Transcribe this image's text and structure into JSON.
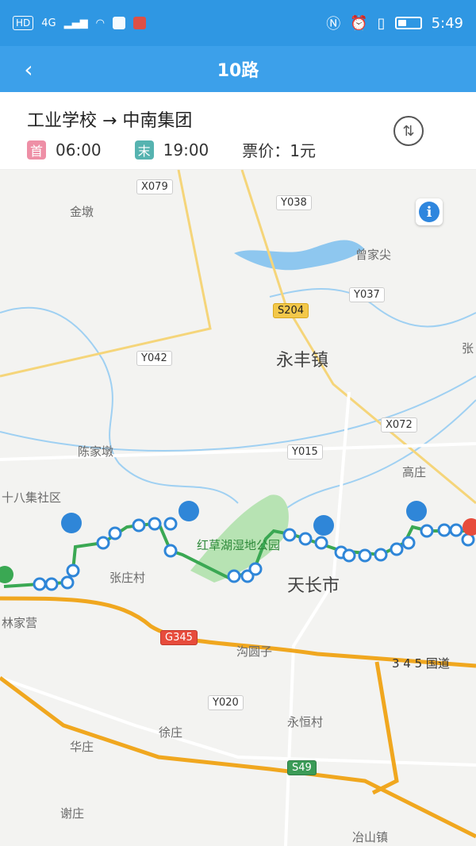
{
  "status_bar": {
    "hd": "HD",
    "network": "4G",
    "time": "5:49",
    "icons": [
      "signal-icon",
      "wifi-icon",
      "music-app-icon",
      "book-app-icon",
      "nfc-icon",
      "alarm-icon",
      "vibrate-icon",
      "battery-icon"
    ]
  },
  "nav": {
    "title": "10路",
    "back_icon": "back-arrow-icon"
  },
  "route": {
    "name": "工业学校 → 中南集团",
    "first_badge": "首",
    "first_time": "06:00",
    "last_badge": "末",
    "last_time": "19:00",
    "fare": "票价：1元",
    "switch_icon": "swap-direction-icon"
  },
  "map": {
    "info_icon": "info-icon",
    "places": [
      "金墩",
      "曾家尖",
      "永丰镇",
      "张",
      "陈家墩",
      "高庄",
      "十八集社区",
      "红草湖湿地公园",
      "张庄村",
      "天长市",
      "林家营",
      "沟圆子",
      "3 4 5 国道",
      "永恒村",
      "徐庄",
      "华庄",
      "谢庄",
      "冶山镇"
    ],
    "roads": [
      "X079",
      "Y038",
      "Y037",
      "S204",
      "Y042",
      "X072",
      "Y015",
      "G345",
      "Y020",
      "S49"
    ],
    "colors": {
      "route": "#3aa853",
      "stop": "#2f86d8",
      "road_major": "#f0a71f",
      "road_minor": "#f5d57a",
      "water": "#8ec7ef"
    }
  }
}
